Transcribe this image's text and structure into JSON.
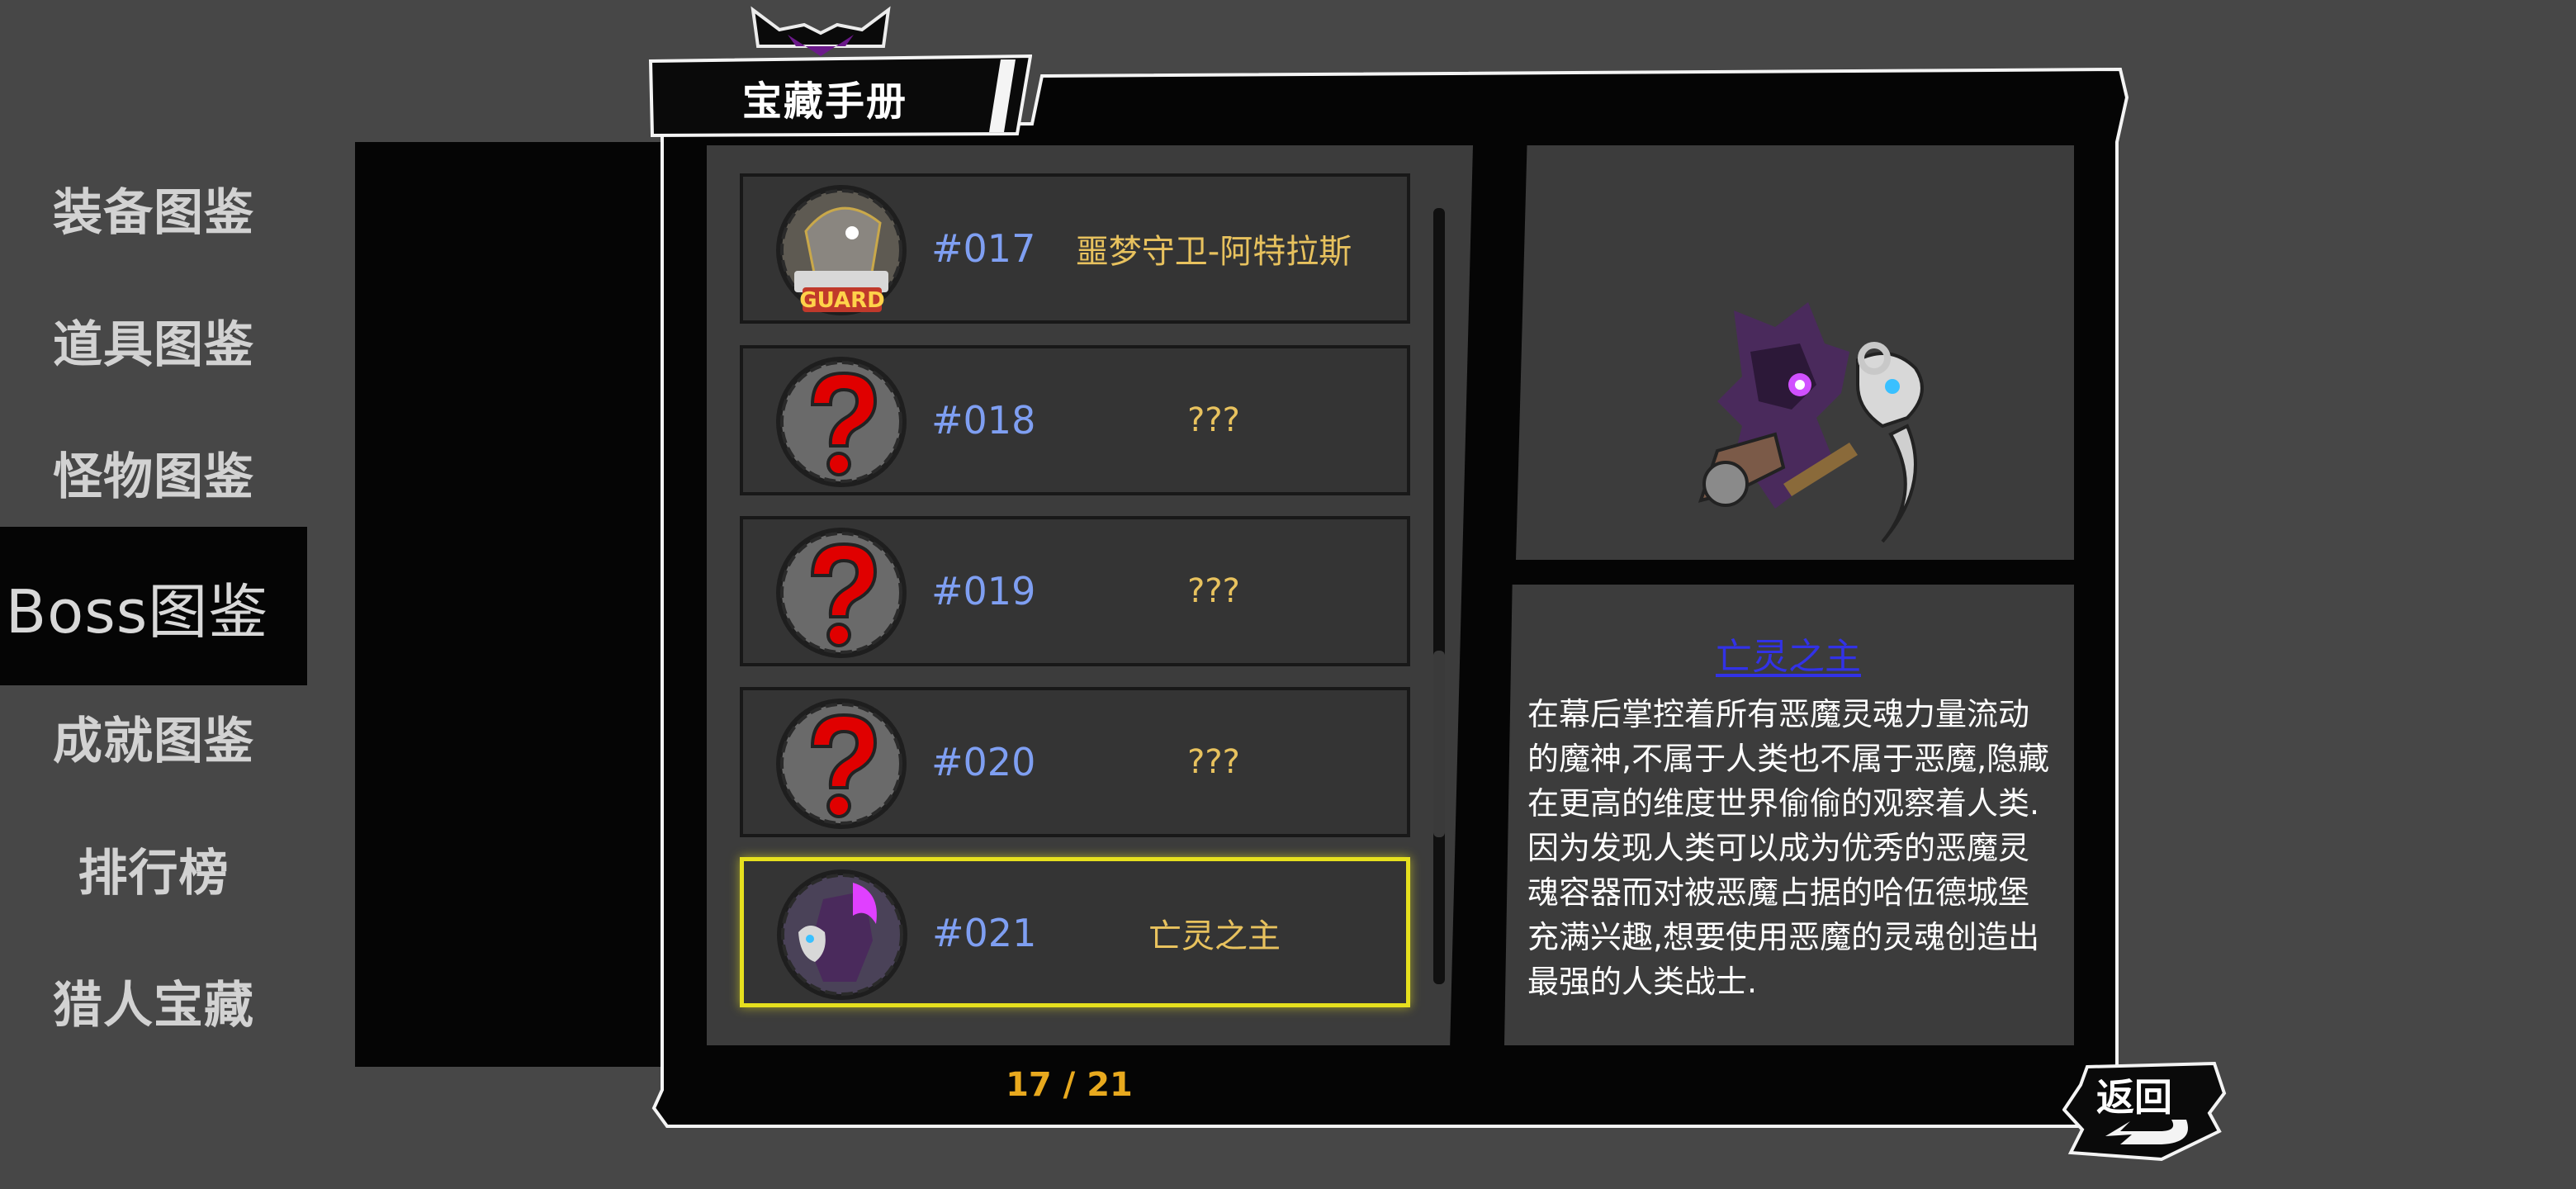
{
  "title": "宝藏手册",
  "sidebar": {
    "items": [
      {
        "label": "装备图鉴",
        "active": false
      },
      {
        "label": "道具图鉴",
        "active": false
      },
      {
        "label": "怪物图鉴",
        "active": false
      },
      {
        "label": "Boss图鉴",
        "active": true
      },
      {
        "label": "成就图鉴",
        "active": false
      },
      {
        "label": "排行榜",
        "active": false
      },
      {
        "label": "猎人宝藏",
        "active": false
      }
    ]
  },
  "list": {
    "rows": [
      {
        "number": "#017",
        "name": "噩梦守卫-阿特拉斯",
        "icon": "nightmare-guard-icon",
        "locked": false,
        "selected": false
      },
      {
        "number": "#018",
        "name": "???",
        "icon": "question-mark-icon",
        "locked": true,
        "selected": false
      },
      {
        "number": "#019",
        "name": "???",
        "icon": "question-mark-icon",
        "locked": true,
        "selected": false
      },
      {
        "number": "#020",
        "name": "???",
        "icon": "question-mark-icon",
        "locked": true,
        "selected": false
      },
      {
        "number": "#021",
        "name": "亡灵之主",
        "icon": "undead-lord-icon",
        "locked": false,
        "selected": true
      }
    ],
    "scroll_position": 0.75
  },
  "pagination": {
    "current": "17",
    "separator": "/",
    "total": "21",
    "text": "17 / 21"
  },
  "detail": {
    "name": "亡灵之主",
    "description": "在幕后掌控着所有恶魔灵魂力量流动的魔神,不属于人类也不属于恶魔,隐藏在更高的维度世界偷偷的观察着人类.因为发现人类可以成为优秀的恶魔灵魂容器而对被恶魔占据的哈伍德城堡充满兴趣,想要使用恶魔的灵魂创造出最强的人类战士."
  },
  "return_button": {
    "label": "返回"
  },
  "colors": {
    "background": "#474747",
    "panel": "#050505",
    "number_text": "#7f9ff2",
    "name_text": "#e8c25e",
    "selected_border": "#e6e01e",
    "boss_name": "#3232e6",
    "page_indicator": "#e8a91e"
  }
}
